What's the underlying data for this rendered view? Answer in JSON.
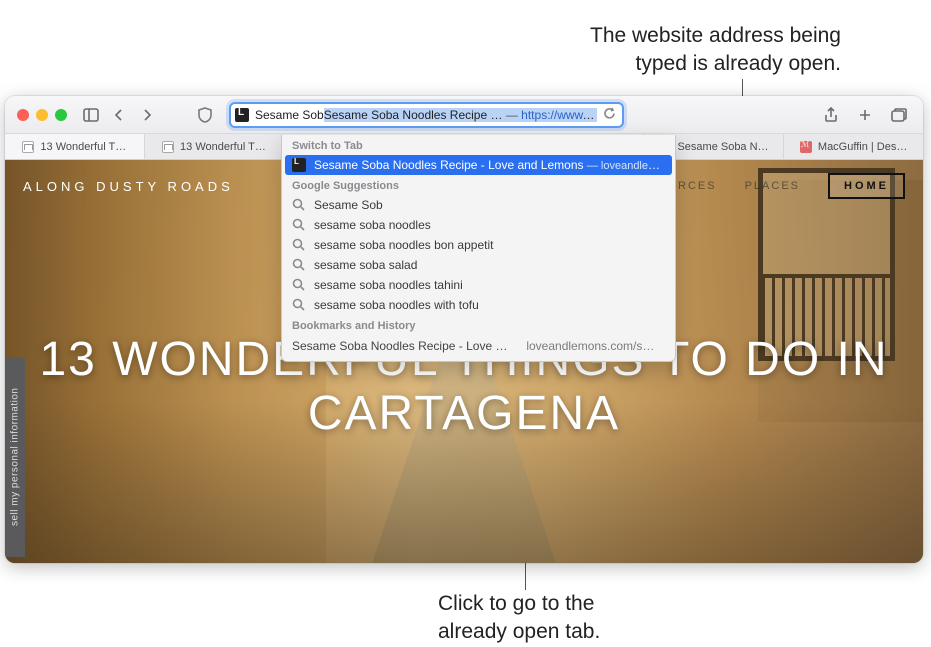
{
  "callouts": {
    "top_line1": "The website address being",
    "top_line2": "typed is already open.",
    "bottom_line1": "Click to go to the",
    "bottom_line2": "already open tab."
  },
  "address_bar": {
    "typed": "Sesame Sob",
    "completion_title": "Sesame Soba Noodles Recipe …",
    "dash": "—",
    "completion_url": "https://www.loveandlemons…"
  },
  "tabs": [
    {
      "label": "13 Wonderful T…",
      "favicon": "generic",
      "active": true
    },
    {
      "label": "13 Wonderful T…",
      "favicon": "generic",
      "active": false
    },
    {
      "label": "",
      "favicon": "none",
      "active": false,
      "hidden_under_dropdown": true
    },
    {
      "label": "Sesame Soba N…",
      "favicon": "l",
      "active": false
    },
    {
      "label": "MacGuffin | Des…",
      "favicon": "m",
      "active": false
    }
  ],
  "suggestions": {
    "switch_header": "Switch to Tab",
    "switch_item": {
      "title": "Sesame Soba Noodles Recipe - Love and Lemons",
      "sub": "— loveandlemons.co…"
    },
    "google_header": "Google Suggestions",
    "google_items": [
      "Sesame Sob",
      "sesame soba noodles",
      "sesame soba noodles bon appetit",
      "sesame soba salad",
      "sesame soba noodles tahini",
      "sesame soba noodles with tofu"
    ],
    "history_header": "Bookmarks and History",
    "history_item": {
      "title": "Sesame Soba Noodles Recipe - Love and Lemo…",
      "url": "loveandlemons.com/s…"
    }
  },
  "page": {
    "brand": "ALONG DUSTY ROADS",
    "nav_sources": "SOURCES",
    "nav_places": "PLACES",
    "nav_home": "HOME",
    "headline_l1": "13 WONDERFUL THINGS TO DO IN",
    "headline_l2": "CARTAGENA",
    "side_tab": "sell my personal information"
  }
}
